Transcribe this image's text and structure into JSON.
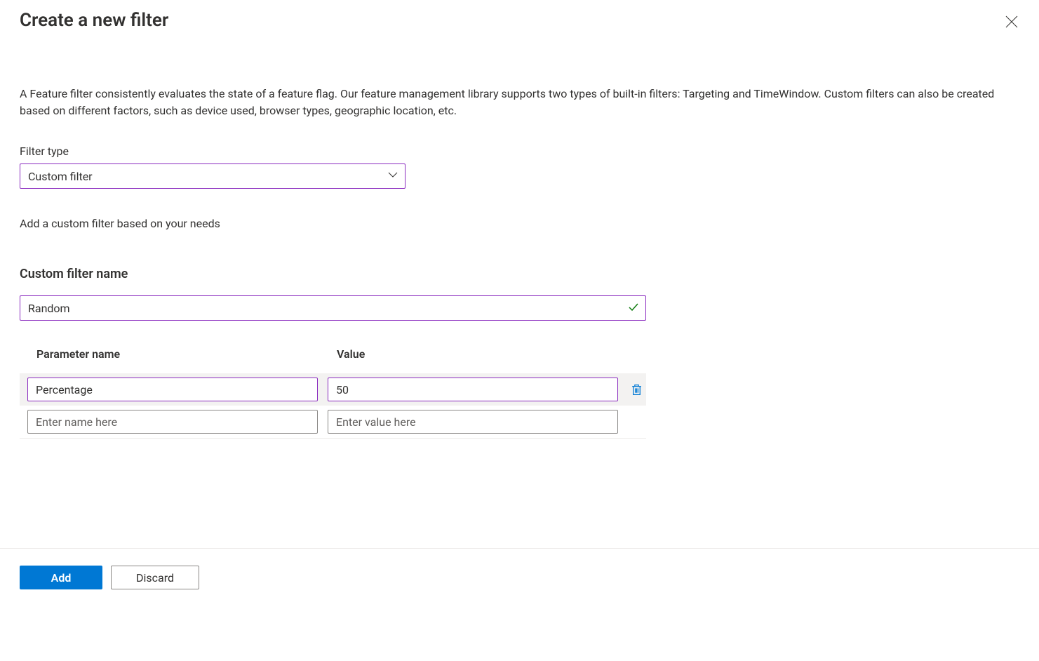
{
  "header": {
    "title": "Create a new filter"
  },
  "description": "A Feature filter consistently evaluates the state of a feature flag. Our feature management library supports two types of built-in filters: Targeting and TimeWindow. Custom filters can also be created based on different factors, such as device used, browser types, geographic location, etc.",
  "filterType": {
    "label": "Filter type",
    "selected": "Custom filter"
  },
  "subtext": "Add a custom filter based on your needs",
  "customFilterName": {
    "heading": "Custom filter name",
    "value": "Random"
  },
  "paramsTable": {
    "headers": {
      "name": "Parameter name",
      "value": "Value"
    },
    "rows": [
      {
        "name": "Percentage",
        "value": "50"
      }
    ],
    "placeholders": {
      "name": "Enter name here",
      "value": "Enter value here"
    }
  },
  "footer": {
    "add": "Add",
    "discard": "Discard"
  }
}
